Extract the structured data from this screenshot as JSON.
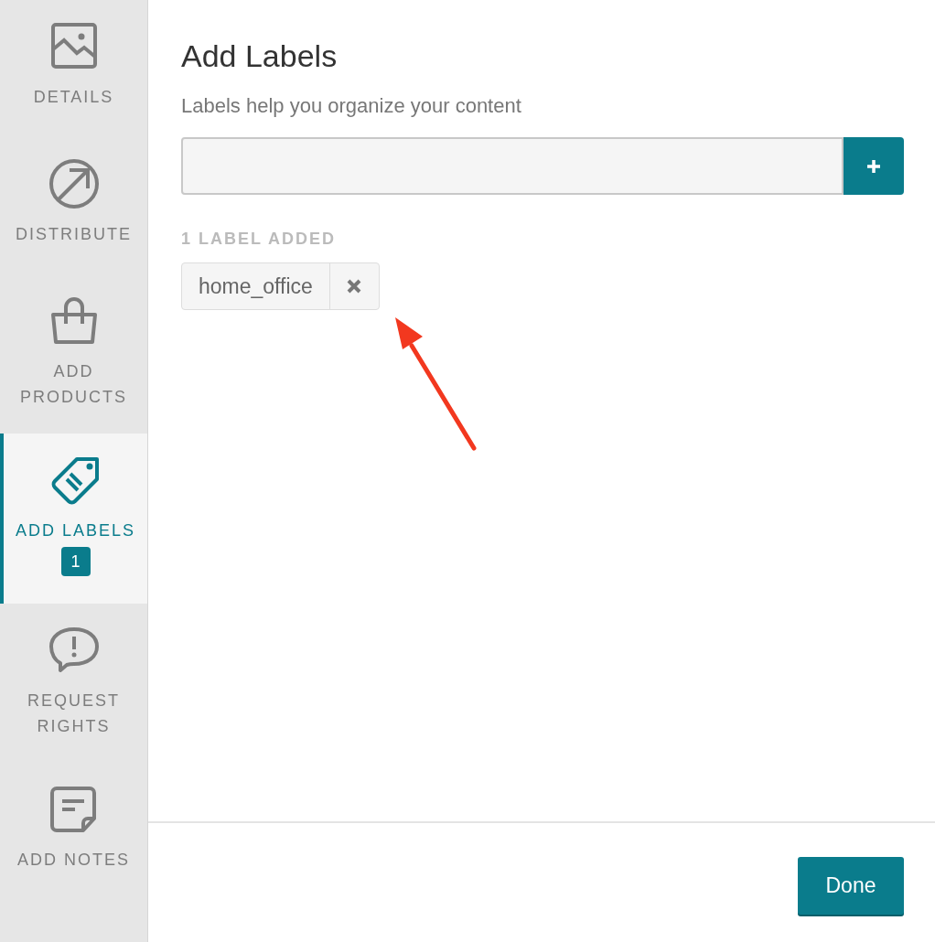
{
  "sidebar": {
    "items": [
      {
        "label": "DETAILS",
        "selected": false
      },
      {
        "label": "DISTRIBUTE",
        "selected": false
      },
      {
        "label": "ADD PRODUCTS",
        "selected": false
      },
      {
        "label": "ADD LABELS",
        "selected": true,
        "badge": "1"
      },
      {
        "label": "REQUEST RIGHTS",
        "selected": false
      },
      {
        "label": "ADD NOTES",
        "selected": false
      }
    ]
  },
  "panel": {
    "title": "Add Labels",
    "subtitle": "Labels help you organize your content",
    "count_heading": "1 LABEL ADDED",
    "labels": [
      {
        "text": "home_office"
      }
    ],
    "done_button": "Done"
  }
}
